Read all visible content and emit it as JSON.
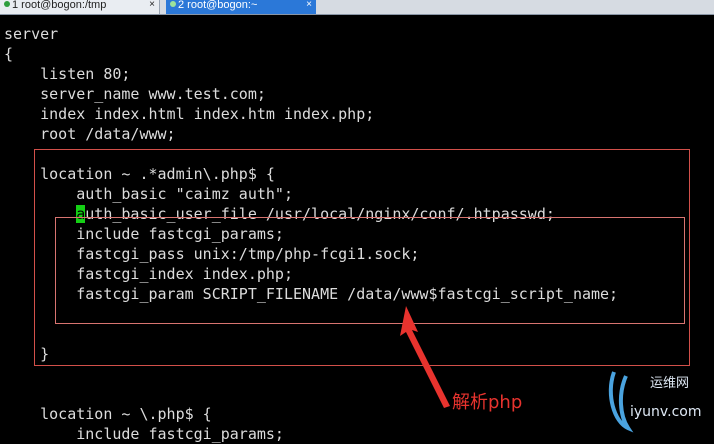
{
  "tabs": [
    {
      "label": "1 root@bogon:/tmp",
      "close": "×"
    },
    {
      "label": "2 root@bogon:~",
      "close": "×"
    }
  ],
  "terminal": {
    "lines": [
      "server",
      "{",
      "    listen 80;",
      "    server_name www.test.com;",
      "    index index.html index.htm index.php;",
      "    root /data/www;",
      "",
      "    location ~ .*admin\\.php$ {",
      "        auth_basic \"caimz auth\";",
      "        auth_basic_user_file /usr/local/nginx/conf/.htpasswd;",
      "        include fastcgi_params;",
      "        fastcgi_pass unix:/tmp/php-fcgi1.sock;",
      "        fastcgi_index index.php;",
      "        fastcgi_param SCRIPT_FILENAME /data/www$fastcgi_script_name;",
      "",
      "    }",
      "",
      "",
      "    location ~ \\.php$ {",
      "        include fastcgi_params;"
    ],
    "cursor_line": 9,
    "cursor_char": "a",
    "cursor_line_rest": "uth_basic_user_file /usr/local/nginx/conf/.htpasswd;",
    "cursor_indent": "        "
  },
  "annotation": {
    "label": "解析php",
    "color": "#e8332e"
  },
  "watermark": {
    "line1": "运维网",
    "line2": "iyunv.com"
  }
}
